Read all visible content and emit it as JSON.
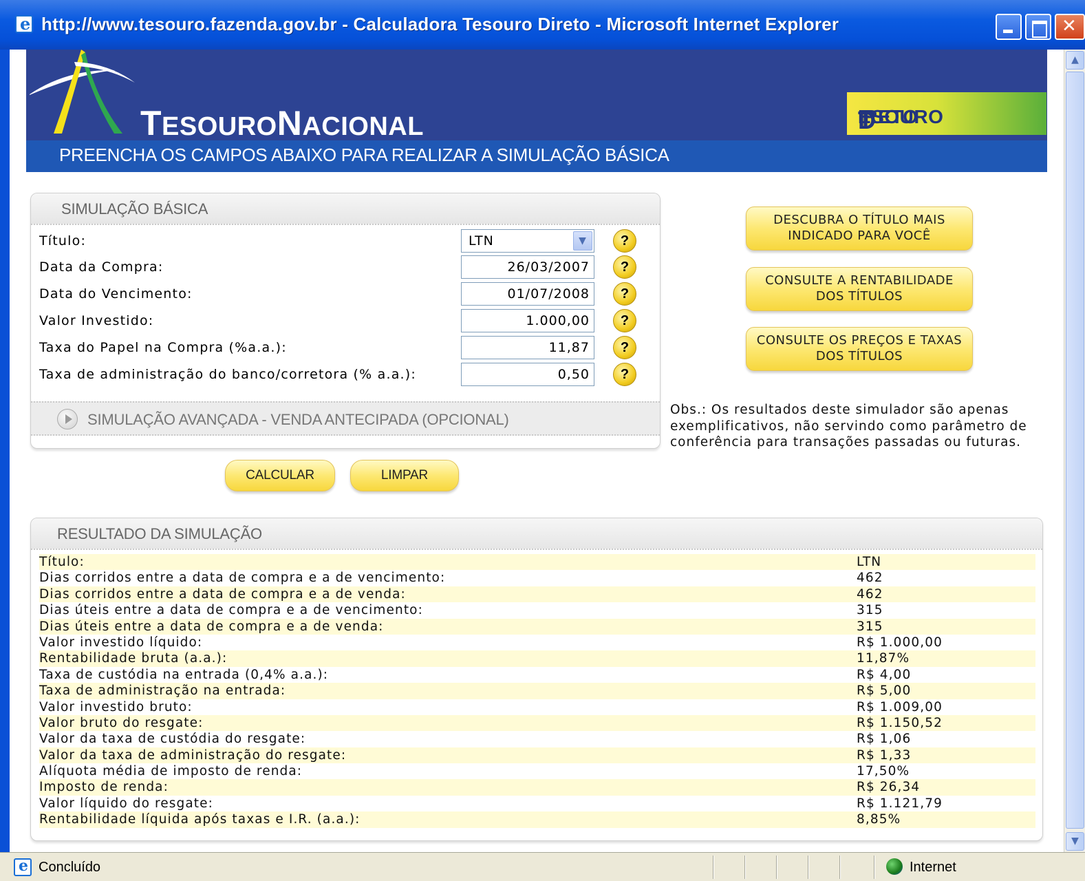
{
  "window": {
    "title": "http://www.tesouro.fazenda.gov.br - Calculadora Tesouro Direto - Microsoft Internet Explorer"
  },
  "header": {
    "logo_first_letter": "T",
    "logo_rest": "ESOURO",
    "logo_second_letter": "N",
    "logo_second_rest": "ACIONAL",
    "badge_first_letter": "T",
    "badge_rest": "ESOURO",
    "badge_second_letter": "D",
    "badge_second_rest": "IRETO",
    "subtitle": "PREENCHA OS CAMPOS ABAIXO PARA REALIZAR A SIMULAÇÃO BÁSICA"
  },
  "simulation": {
    "heading": "SIMULAÇÃO BÁSICA",
    "fields": [
      {
        "label": "Título:",
        "value": "LTN"
      },
      {
        "label": "Data da Compra:",
        "value": "26/03/2007"
      },
      {
        "label": "Data do Vencimento:",
        "value": "01/07/2008"
      },
      {
        "label": "Valor Investido:",
        "value": "1.000,00"
      },
      {
        "label": "Taxa do Papel na Compra (%a.a.):",
        "value": "11,87"
      },
      {
        "label": "Taxa de administração do banco/corretora (% a.a.):",
        "value": "0,50"
      }
    ],
    "help_symbol": "?",
    "advanced": "SIMULAÇÃO AVANÇADA - VENDA ANTECIPADA (OPCIONAL)",
    "calcular_label": "CALCULAR",
    "limpar_label": "LIMPAR"
  },
  "side_buttons": [
    {
      "line1": "DESCUBRA O TÍTULO MAIS",
      "line2": "INDICADO PARA VOCÊ"
    },
    {
      "line1": "CONSULTE A RENTABILIDADE",
      "line2": "DOS TÍTULOS"
    },
    {
      "line1": "CONSULTE OS PREÇOS E TAXAS",
      "line2": "DOS TÍTULOS"
    }
  ],
  "obs": "Obs.: Os resultados deste simulador são apenas exemplificativos, não servindo como parâmetro de conferência para transações passadas ou futuras.",
  "result": {
    "heading": "RESULTADO DA SIMULAÇÃO",
    "rows": [
      {
        "label": "Título:",
        "value": "LTN"
      },
      {
        "label": "Dias corridos entre a data de compra e a de vencimento:",
        "value": "462"
      },
      {
        "label": "Dias corridos entre a data de compra e a de venda:",
        "value": "462"
      },
      {
        "label": "Dias úteis entre a data de compra e a de vencimento:",
        "value": "315"
      },
      {
        "label": "Dias úteis entre a data de compra e a de venda:",
        "value": "315"
      },
      {
        "label": "Valor investido líquido:",
        "value": "R$ 1.000,00"
      },
      {
        "label": "Rentabilidade bruta (a.a.):",
        "value": "11,87%"
      },
      {
        "label": "Taxa de custódia na entrada (0,4% a.a.):",
        "value": "R$ 4,00"
      },
      {
        "label": "Taxa de administração na entrada:",
        "value": "R$ 5,00"
      },
      {
        "label": "Valor investido bruto:",
        "value": "R$ 1.009,00"
      },
      {
        "label": "Valor bruto do resgate:",
        "value": "R$ 1.150,52"
      },
      {
        "label": "Valor da taxa de custódia do resgate:",
        "value": "R$ 1,06"
      },
      {
        "label": "Valor da taxa de administração do resgate:",
        "value": "R$ 1,33"
      },
      {
        "label": "Alíquota média de imposto de renda:",
        "value": "17,50%"
      },
      {
        "label": "Imposto de renda:",
        "value": "R$ 26,34"
      },
      {
        "label": "Valor líquido do resgate:",
        "value": "R$ 1.121,79"
      },
      {
        "label": "Rentabilidade líquida após taxas e I.R. (a.a.):",
        "value": "8,85%"
      }
    ]
  },
  "status": {
    "text": "Concluído",
    "zone": "Internet"
  },
  "colors": {
    "banner": "#2d4393",
    "subhead": "#1f58b5",
    "button_yellow": "#fde872",
    "result_row_alt": "#fffbd6"
  }
}
